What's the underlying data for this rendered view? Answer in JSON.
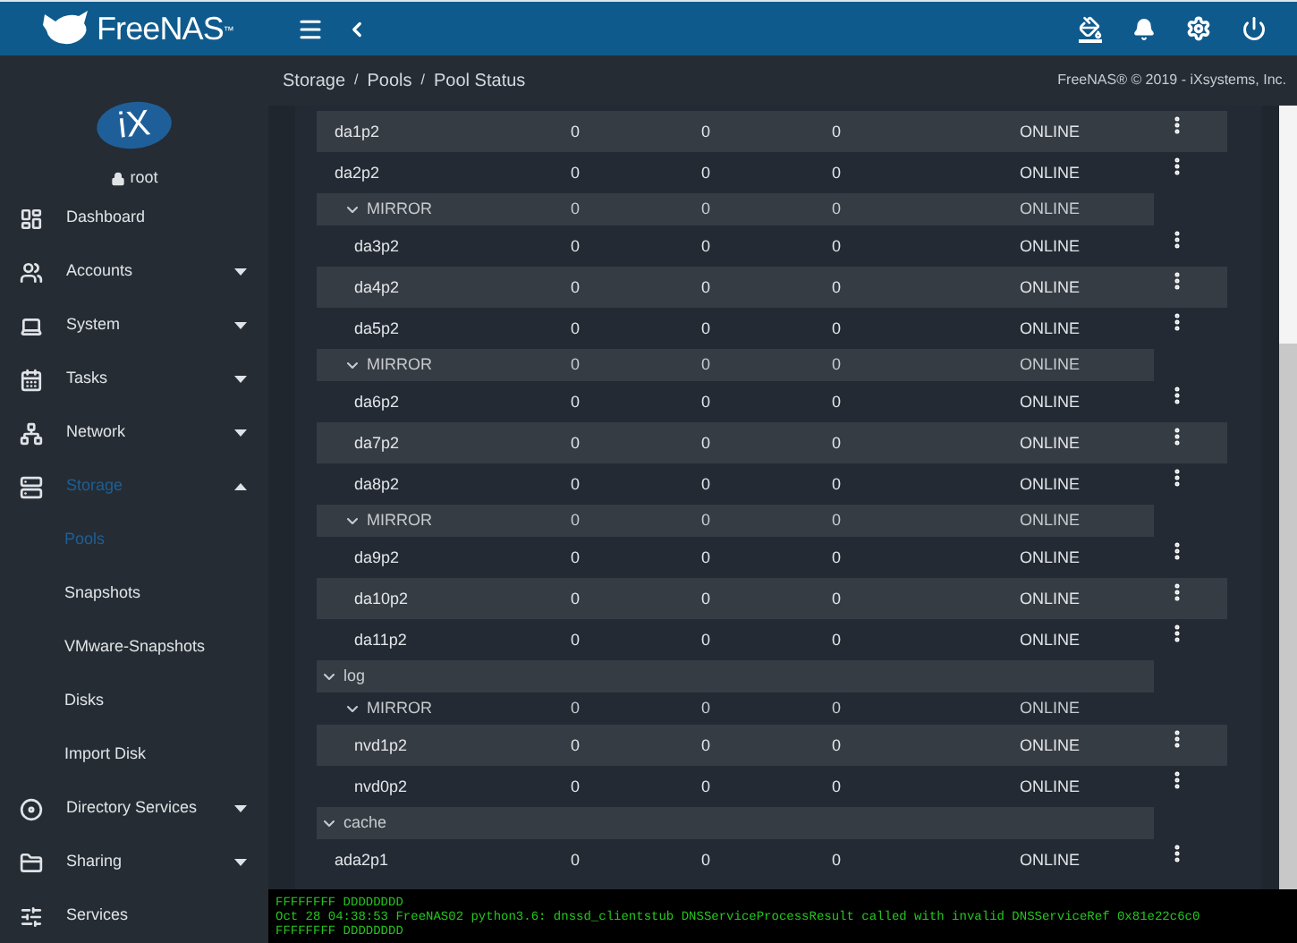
{
  "header": {
    "brand": "FreeNAS",
    "trademark": "™"
  },
  "breadcrumb": [
    {
      "kind": "link",
      "text": "Storage"
    },
    {
      "kind": "separator",
      "text": "/"
    },
    {
      "kind": "link",
      "text": "Pools"
    },
    {
      "kind": "separator",
      "text": "/"
    },
    {
      "kind": "current",
      "text": "Pool Status"
    }
  ],
  "copyright": "FreeNAS® © 2019 - iXsystems, Inc.",
  "user": {
    "logo": "iX",
    "name": "root"
  },
  "sidebar": [
    {
      "label": "Dashboard",
      "has_caret": false,
      "selected": false
    },
    {
      "label": "Accounts",
      "has_caret": true,
      "expanded": false,
      "selected": false
    },
    {
      "label": "System",
      "has_caret": true,
      "expanded": false,
      "selected": false
    },
    {
      "label": "Tasks",
      "has_caret": true,
      "expanded": false,
      "selected": false
    },
    {
      "label": "Network",
      "has_caret": true,
      "expanded": false,
      "selected": false
    },
    {
      "label": "Storage",
      "has_caret": true,
      "expanded": true,
      "selected": true,
      "children": [
        {
          "label": "Pools",
          "selected": true
        },
        {
          "label": "Snapshots",
          "selected": false
        },
        {
          "label": "VMware-Snapshots",
          "selected": false
        },
        {
          "label": "Disks",
          "selected": false
        },
        {
          "label": "Import Disk",
          "selected": false
        }
      ]
    },
    {
      "label": "Directory Services",
      "has_caret": true,
      "expanded": false,
      "selected": false
    },
    {
      "label": "Sharing",
      "has_caret": true,
      "expanded": false,
      "selected": false
    },
    {
      "label": "Services",
      "has_caret": false,
      "selected": false
    }
  ],
  "data_rows": [
    {
      "kind": "disk",
      "name": "da1p2",
      "read": "0",
      "write": "0",
      "checksum": "0",
      "status": "ONLINE"
    },
    {
      "kind": "disk",
      "name": "da2p2",
      "read": "0",
      "write": "0",
      "checksum": "0",
      "status": "ONLINE"
    },
    {
      "kind": "group",
      "name": "MIRROR",
      "read": "0",
      "write": "0",
      "checksum": "0",
      "status": "ONLINE",
      "expanded": true,
      "children": [
        {
          "kind": "disk",
          "name": "da3p2",
          "read": "0",
          "write": "0",
          "checksum": "0",
          "status": "ONLINE"
        },
        {
          "kind": "disk",
          "name": "da4p2",
          "read": "0",
          "write": "0",
          "checksum": "0",
          "status": "ONLINE"
        },
        {
          "kind": "disk",
          "name": "da5p2",
          "read": "0",
          "write": "0",
          "checksum": "0",
          "status": "ONLINE"
        }
      ]
    },
    {
      "kind": "group",
      "name": "MIRROR",
      "read": "0",
      "write": "0",
      "checksum": "0",
      "status": "ONLINE",
      "expanded": true,
      "children": [
        {
          "kind": "disk",
          "name": "da6p2",
          "read": "0",
          "write": "0",
          "checksum": "0",
          "status": "ONLINE"
        },
        {
          "kind": "disk",
          "name": "da7p2",
          "read": "0",
          "write": "0",
          "checksum": "0",
          "status": "ONLINE"
        },
        {
          "kind": "disk",
          "name": "da8p2",
          "read": "0",
          "write": "0",
          "checksum": "0",
          "status": "ONLINE"
        }
      ]
    },
    {
      "kind": "group",
      "name": "MIRROR",
      "read": "0",
      "write": "0",
      "checksum": "0",
      "status": "ONLINE",
      "expanded": true,
      "children": [
        {
          "kind": "disk",
          "name": "da9p2",
          "read": "0",
          "write": "0",
          "checksum": "0",
          "status": "ONLINE"
        },
        {
          "kind": "disk",
          "name": "da10p2",
          "read": "0",
          "write": "0",
          "checksum": "0",
          "status": "ONLINE"
        },
        {
          "kind": "disk",
          "name": "da11p2",
          "read": "0",
          "write": "0",
          "checksum": "0",
          "status": "ONLINE"
        }
      ]
    }
  ],
  "tree": [
    {
      "kind": "group",
      "name": "log",
      "expanded": true,
      "children": [
        {
          "kind": "group",
          "name": "MIRROR",
          "read": "0",
          "write": "0",
          "checksum": "0",
          "status": "ONLINE",
          "expanded": true,
          "children": [
            {
              "kind": "disk",
              "name": "nvd1p2",
              "read": "0",
              "write": "0",
              "checksum": "0",
              "status": "ONLINE"
            },
            {
              "kind": "disk",
              "name": "nvd0p2",
              "read": "0",
              "write": "0",
              "checksum": "0",
              "status": "ONLINE"
            }
          ]
        }
      ]
    },
    {
      "kind": "group",
      "name": "cache",
      "expanded": true,
      "children": [
        {
          "kind": "disk",
          "name": "ada2p1",
          "read": "0",
          "write": "0",
          "checksum": "0",
          "status": "ONLINE"
        }
      ]
    }
  ],
  "console": [
    "FFFFFFFF DDDDDDDD",
    "Oct 28 04:38:53 FreeNAS02 python3.6: dnssd_clientstub DNSServiceProcessResult called with invalid DNSServiceRef 0x81e22c6c0",
    "FFFFFFFF DDDDDDDD"
  ]
}
